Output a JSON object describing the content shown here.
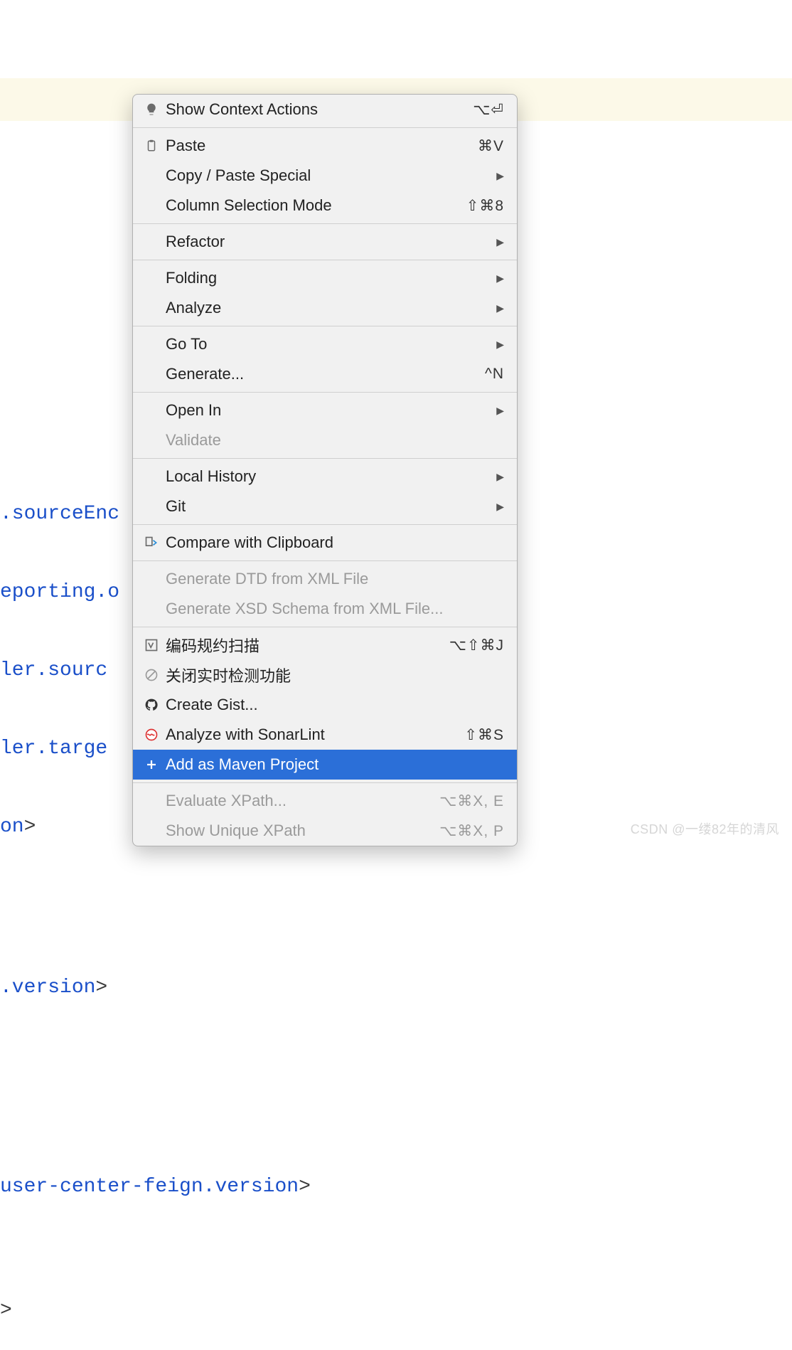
{
  "code_lines": {
    "l1": ".sourceEnc",
    "l2": "eporting.o",
    "l3": "ler.sourc",
    "l4": "ler.targe",
    "l5a": "on",
    "l5b": ">",
    "l6a": ".version",
    "l6b": ">",
    "l7a": "user-center-feign.version",
    "l7b": ">",
    "l8": ">"
  },
  "menu": {
    "show_context_actions": {
      "label": "Show Context Actions",
      "shortcut": "⌥⏎"
    },
    "paste": {
      "label": "Paste",
      "shortcut": "⌘V"
    },
    "copy_paste_special": {
      "label": "Copy / Paste Special"
    },
    "column_selection_mode": {
      "label": "Column Selection Mode",
      "shortcut": "⇧⌘8"
    },
    "refactor": {
      "label": "Refactor"
    },
    "folding": {
      "label": "Folding"
    },
    "analyze": {
      "label": "Analyze"
    },
    "go_to": {
      "label": "Go To"
    },
    "generate": {
      "label": "Generate...",
      "shortcut": "^N"
    },
    "open_in": {
      "label": "Open In"
    },
    "validate": {
      "label": "Validate"
    },
    "local_history": {
      "label": "Local History"
    },
    "git": {
      "label": "Git"
    },
    "compare_clipboard": {
      "label": "Compare with Clipboard"
    },
    "generate_dtd": {
      "label": "Generate DTD from XML File"
    },
    "generate_xsd": {
      "label": "Generate XSD Schema from XML File..."
    },
    "bianma": {
      "label": "编码规约扫描",
      "shortcut": "⌥⇧⌘J"
    },
    "guanbi": {
      "label": "关闭实时检测功能"
    },
    "create_gist": {
      "label": "Create Gist..."
    },
    "sonarlint": {
      "label": "Analyze with SonarLint",
      "shortcut": "⇧⌘S"
    },
    "add_maven": {
      "label": "Add as Maven Project"
    },
    "eval_xpath": {
      "label": "Evaluate XPath...",
      "shortcut": "⌥⌘X, E"
    },
    "show_xpath": {
      "label": "Show Unique XPath",
      "shortcut": "⌥⌘X, P"
    }
  },
  "watermark": "CSDN @一缕82年的清风"
}
